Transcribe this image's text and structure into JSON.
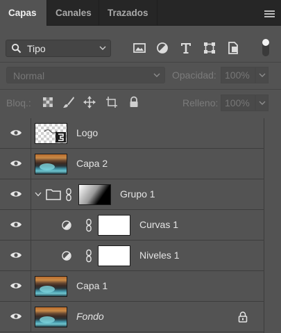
{
  "tabs": [
    {
      "label": "Capas",
      "active": true
    },
    {
      "label": "Canales",
      "active": false
    },
    {
      "label": "Trazados",
      "active": false
    }
  ],
  "filter": {
    "kind_label": "Tipo",
    "icons": [
      "image-filter-icon",
      "adjustment-filter-icon",
      "type-filter-icon",
      "shape-filter-icon",
      "smart-object-filter-icon"
    ]
  },
  "blend": {
    "mode": "Normal",
    "opacity_label": "Opacidad:",
    "opacity_value": "100%"
  },
  "lock": {
    "label": "Bloq.:",
    "fill_label": "Relleno:",
    "fill_value": "100%"
  },
  "layers": [
    {
      "name": "Logo",
      "type": "smart-object",
      "thumb": "checker",
      "italic": false
    },
    {
      "name": "Capa 2",
      "type": "pixel",
      "thumb": "photo",
      "italic": false
    },
    {
      "name": "Grupo 1",
      "type": "group",
      "thumb": "gradient-mask",
      "italic": false,
      "expanded": true
    },
    {
      "name": "Curvas 1",
      "type": "adjustment",
      "thumb": "white-mask",
      "italic": false
    },
    {
      "name": "Niveles 1",
      "type": "adjustment",
      "thumb": "white-mask",
      "italic": false
    },
    {
      "name": "Capa 1",
      "type": "pixel",
      "thumb": "photo",
      "italic": false
    },
    {
      "name": "Fondo",
      "type": "background",
      "thumb": "photo",
      "italic": true,
      "locked": true
    }
  ],
  "colors": {
    "panel": "#535353",
    "tabbar": "#262626",
    "text": "#e4e4e4"
  }
}
